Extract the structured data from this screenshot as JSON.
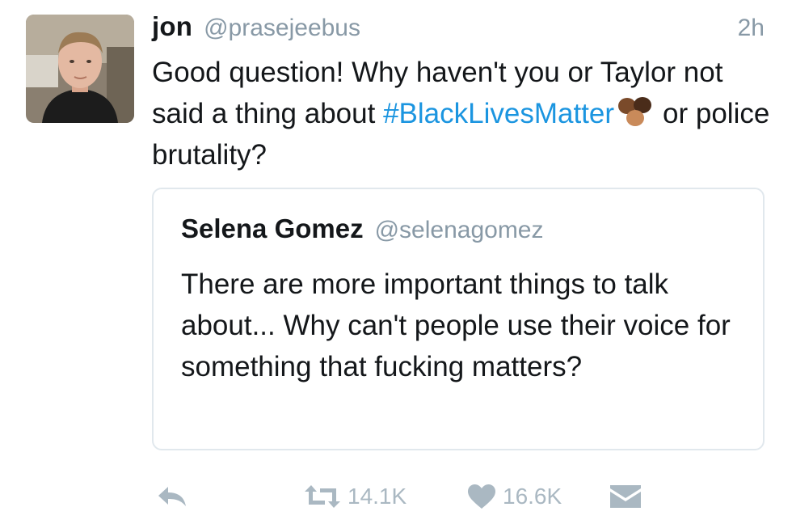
{
  "author": {
    "display_name": "jon",
    "handle": "@prasejeebus",
    "timestamp": "2h"
  },
  "tweet": {
    "text_before": "Good question! Why haven't you or Taylor not said a thing about ",
    "hashtag": "#BlackLivesMatter",
    "text_after": "or police brutality?"
  },
  "quoted_tweet": {
    "display_name": "Selena Gomez",
    "handle": "@selenagomez",
    "text": "There are more important things to talk about... Why can't people use their voice for something that fucking matters?"
  },
  "actions": {
    "retweet_count": "14.1K",
    "like_count": "16.6K"
  },
  "colors": {
    "text": "#14171a",
    "secondary": "#8899a6",
    "link": "#1b95e0",
    "action_icon": "#aab8c2",
    "card_border": "#e1e8ed"
  },
  "icons": [
    "reply-icon",
    "retweet-icon",
    "heart-icon",
    "direct-message-icon",
    "raised-fists-icon"
  ]
}
